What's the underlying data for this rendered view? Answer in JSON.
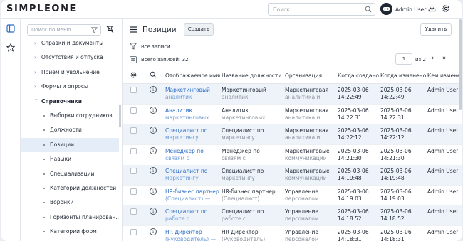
{
  "app": {
    "logo": "SIMPLEONE"
  },
  "header": {
    "search_placeholder": "Поиск",
    "user_name": "Admin User"
  },
  "sidebar": {
    "search_placeholder": "Поиск по меню",
    "items": [
      {
        "label": "Справки и документы",
        "type": "collapsed"
      },
      {
        "label": "Отсутствия и отпуска",
        "type": "collapsed"
      },
      {
        "label": "Прием и увольнение",
        "type": "collapsed"
      },
      {
        "label": "Формы и опросы",
        "type": "collapsed"
      },
      {
        "label": "Справочники",
        "type": "expanded"
      },
      {
        "label": "Выборки сотрудников",
        "type": "child"
      },
      {
        "label": "Должности",
        "type": "child"
      },
      {
        "label": "Позиции",
        "type": "child-active"
      },
      {
        "label": "Навыки",
        "type": "child"
      },
      {
        "label": "Специализации",
        "type": "child"
      },
      {
        "label": "Категории должностей",
        "type": "child"
      },
      {
        "label": "Воронки",
        "type": "child"
      },
      {
        "label": "Горизонты планирован...",
        "type": "child"
      },
      {
        "label": "Категории форм",
        "type": "child"
      }
    ]
  },
  "main": {
    "title": "Позиции",
    "create_label": "Создать",
    "delete_label": "Удалить",
    "filter_label": "Все записи",
    "count_label": "Всего записей: 32",
    "page_current": "1",
    "page_of": "из 2"
  },
  "table": {
    "columns": [
      "Отображаемое имя",
      "Название должности",
      "Организация",
      "Когда создано",
      "Когда изменено",
      "Кем измене"
    ],
    "rows": [
      {
        "name": [
          "Маркетинговый",
          "аналитик"
        ],
        "position": [
          "Маркетинговый",
          "аналитик"
        ],
        "org": [
          "Маркетинговая",
          "аналитика и"
        ],
        "created": [
          "2025-03-06",
          "14:22:49"
        ],
        "updated": [
          "2025-03-06",
          "14:22:49"
        ],
        "by": "Admin User"
      },
      {
        "name": [
          "Аналитик",
          "маркетинговых"
        ],
        "position": [
          "Аналитик",
          "маркетинговых"
        ],
        "org": [
          "Маркетинговая",
          "аналитика и"
        ],
        "created": [
          "2025-03-06",
          "14:22:31"
        ],
        "updated": [
          "2025-03-06",
          "14:22:31"
        ],
        "by": "Admin User"
      },
      {
        "name": [
          "Специалист по",
          "маркетингу"
        ],
        "position": [
          "Специалист по",
          "маркетингу"
        ],
        "org": [
          "Маркетинговая",
          "аналитика и"
        ],
        "created": [
          "2025-03-06",
          "14:22:12"
        ],
        "updated": [
          "2025-03-06",
          "14:22:12"
        ],
        "by": "Admin User"
      },
      {
        "name": [
          "Менеджер по",
          "связям с"
        ],
        "position": [
          "Менеджер по",
          "связям с"
        ],
        "org": [
          "Маркетинговые",
          "коммуникации"
        ],
        "created": [
          "2025-03-06",
          "14:21:30"
        ],
        "updated": [
          "2025-03-06",
          "14:21:30"
        ],
        "by": "Admin User"
      },
      {
        "name": [
          "Специалист по",
          "маркетингу"
        ],
        "position": [
          "Специалист по",
          "маркетингу"
        ],
        "org": [
          "Маркетинговые",
          "коммуникации"
        ],
        "created": [
          "2025-03-06",
          "14:19:48"
        ],
        "updated": [
          "2025-03-06",
          "14:19:48"
        ],
        "by": "Admin User"
      },
      {
        "name": [
          "HR-бизнес партнер",
          "(Специалист) —"
        ],
        "position": [
          "HR-бизнес партнер",
          "(Специалист)"
        ],
        "org": [
          "Управление",
          "персоналом"
        ],
        "created": [
          "2025-03-06",
          "14:19:03"
        ],
        "updated": [
          "2025-03-06",
          "14:19:03"
        ],
        "by": "Admin User"
      },
      {
        "name": [
          "Специалист по",
          "работе с"
        ],
        "position": [
          "Специалист по",
          "работе с"
        ],
        "org": [
          "Управление",
          "персоналом"
        ],
        "created": [
          "2025-03-06",
          "14:18:52"
        ],
        "updated": [
          "2025-03-06",
          "14:18:52"
        ],
        "by": "Admin User"
      },
      {
        "name": [
          "HR Директор",
          "(Руководитель) —"
        ],
        "position": [
          "HR Директор",
          "(Руководитель)"
        ],
        "org": [
          "Управление",
          "персоналом"
        ],
        "created": [
          "2025-03-06",
          "14:18:31"
        ],
        "updated": [
          "2025-03-06",
          "14:18:31"
        ],
        "by": "Admin User"
      }
    ]
  },
  "icons": {
    "search": "search-icon",
    "bot": "avatar-icon",
    "download": "download-icon",
    "settings": "gear-icon",
    "panel": "panel-icon",
    "star": "star-icon",
    "filter": "filter-icon",
    "unpin": "unpin-icon",
    "menu": "hamburger-icon",
    "list": "list-icon",
    "info": "info-icon"
  },
  "colors": {
    "link": "#2b6cc4",
    "active": "#e4edf8",
    "row_alt": "#eef3fa"
  }
}
